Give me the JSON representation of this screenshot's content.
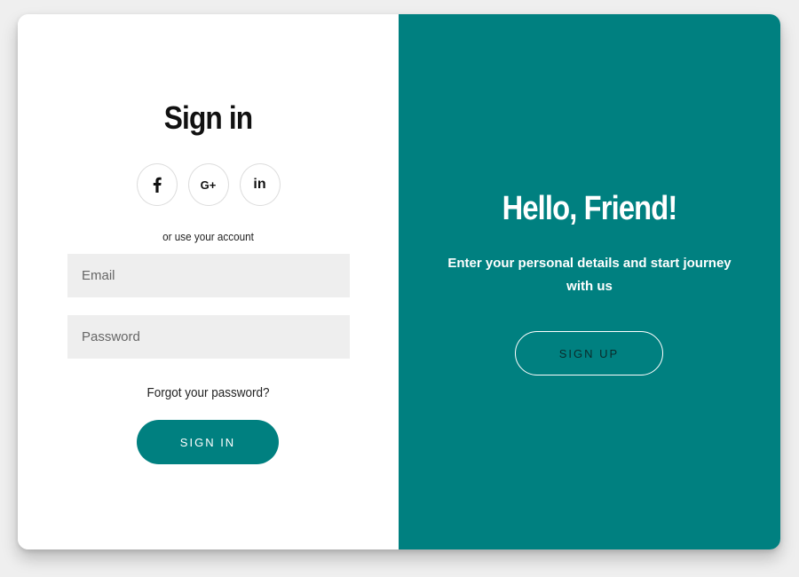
{
  "colors": {
    "page_background": "#efefef",
    "card_background": "#ffffff",
    "accent": "#008080",
    "input_background": "#eeeeee"
  },
  "sign_in": {
    "title": "Sign in",
    "social": [
      {
        "icon": "facebook-icon",
        "glyph": "f"
      },
      {
        "icon": "google-plus-icon",
        "glyph": "G+"
      },
      {
        "icon": "linkedin-icon",
        "glyph": "in"
      }
    ],
    "alt_text": "or use your account",
    "email": {
      "placeholder": "Email",
      "value": ""
    },
    "password": {
      "placeholder": "Password",
      "value": ""
    },
    "forgot_label": "Forgot your password?",
    "button_label": "SIGN IN"
  },
  "welcome": {
    "title": "Hello, Friend!",
    "subtitle": "Enter your personal details and start journey with us",
    "button_label": "SIGN UP"
  }
}
